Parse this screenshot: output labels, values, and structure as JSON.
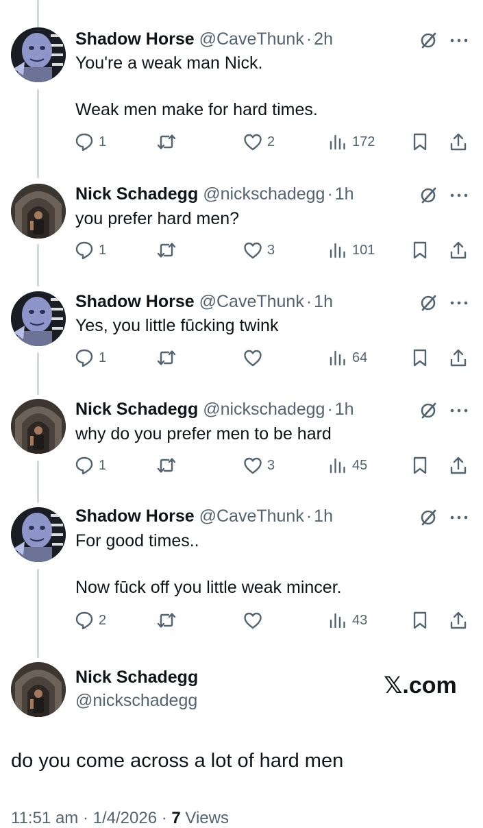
{
  "colors": {
    "text": "#0f1419",
    "muted": "#536471",
    "thread_line": "#cfd9de"
  },
  "replies": [
    {
      "name": "Shadow Horse",
      "handle": "@CaveThunk",
      "time": "2h",
      "text": "You're a weak man Nick.\n\nWeak men make for hard times.",
      "reply_count": "1",
      "retweet_count": "",
      "like_count": "2",
      "view_count": "172"
    },
    {
      "name": "Nick Schadegg",
      "handle": "@nickschadegg",
      "time": "1h",
      "text": "you prefer hard men?",
      "reply_count": "1",
      "retweet_count": "",
      "like_count": "3",
      "view_count": "101"
    },
    {
      "name": "Shadow Horse",
      "handle": "@CaveThunk",
      "time": "1h",
      "text": "Yes, you little fūcking twink",
      "reply_count": "1",
      "retweet_count": "",
      "like_count": "",
      "view_count": "64"
    },
    {
      "name": "Nick Schadegg",
      "handle": "@nickschadegg",
      "time": "1h",
      "text": "why do you prefer men to be hard",
      "reply_count": "1",
      "retweet_count": "",
      "like_count": "3",
      "view_count": "45"
    },
    {
      "name": "Shadow Horse",
      "handle": "@CaveThunk",
      "time": "1h",
      "text": "For good times..\n\nNow fūck off you little weak mincer.",
      "reply_count": "2",
      "retweet_count": "",
      "like_count": "",
      "view_count": "43"
    }
  ],
  "main_post": {
    "name": "Nick Schadegg",
    "handle": "@nickschadegg",
    "brand": "𝕏.com",
    "text": "do you come across a lot of hard men",
    "time": "11:51 am · 1/4/2026 · ",
    "views_count": "7",
    "views_label": " Views"
  },
  "icons": [
    "grok-icon",
    "more-icon",
    "reply-icon",
    "retweet-icon",
    "like-icon",
    "views-icon",
    "bookmark-icon",
    "share-icon"
  ]
}
